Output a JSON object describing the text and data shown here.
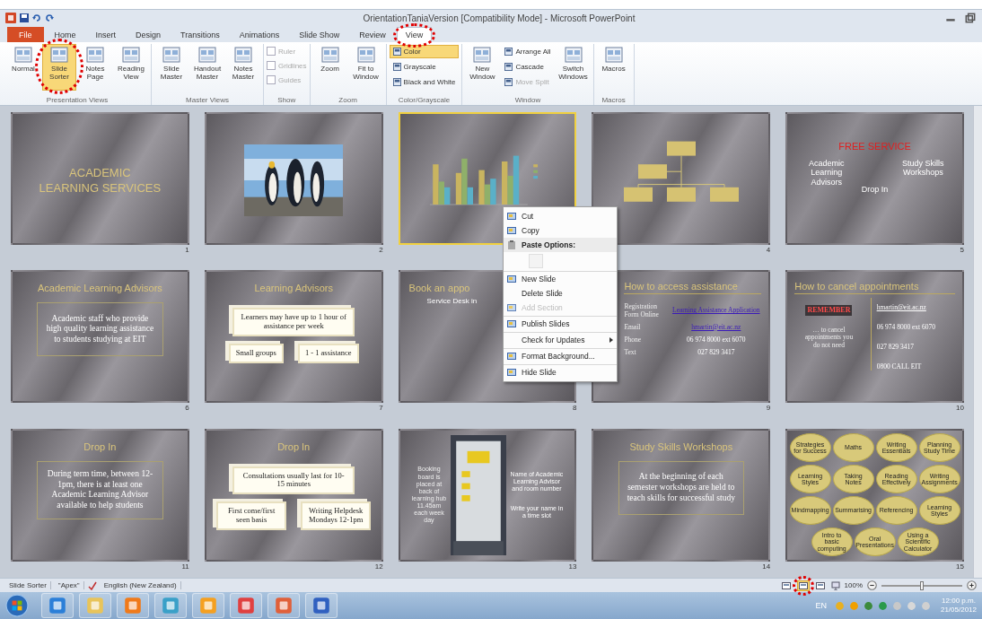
{
  "window": {
    "title": "OrientationTaniaVersion [Compatibility Mode] - Microsoft PowerPoint"
  },
  "tabs": [
    {
      "label": "File",
      "kind": "file",
      "selected": false,
      "circled": false
    },
    {
      "label": "Home",
      "kind": "tab",
      "selected": false,
      "circled": false
    },
    {
      "label": "Insert",
      "kind": "tab",
      "selected": false,
      "circled": false
    },
    {
      "label": "Design",
      "kind": "tab",
      "selected": false,
      "circled": false
    },
    {
      "label": "Transitions",
      "kind": "tab",
      "selected": false,
      "circled": false
    },
    {
      "label": "Animations",
      "kind": "tab",
      "selected": false,
      "circled": false
    },
    {
      "label": "Slide Show",
      "kind": "tab",
      "selected": false,
      "circled": false
    },
    {
      "label": "Review",
      "kind": "tab",
      "selected": false,
      "circled": false
    },
    {
      "label": "View",
      "kind": "tab",
      "selected": true,
      "circled": true
    }
  ],
  "ribbon": [
    {
      "label": "Presentation Views",
      "items": [
        {
          "kind": "large",
          "label": "Normal",
          "selected": false,
          "circled": false
        },
        {
          "kind": "large",
          "label": "Slide Sorter",
          "selected": true,
          "circled": true
        },
        {
          "kind": "large",
          "label": "Notes Page",
          "selected": false,
          "circled": false
        },
        {
          "kind": "large",
          "label": "Reading View",
          "selected": false,
          "circled": false
        }
      ]
    },
    {
      "label": "Master Views",
      "items": [
        {
          "kind": "large",
          "label": "Slide Master",
          "selected": false,
          "circled": false
        },
        {
          "kind": "large",
          "label": "Handout Master",
          "selected": false,
          "circled": false
        },
        {
          "kind": "large",
          "label": "Notes Master",
          "selected": false,
          "circled": false
        }
      ]
    },
    {
      "label": "Show",
      "items": [
        {
          "kind": "check",
          "label": "Ruler",
          "checked": false,
          "disabled": true
        },
        {
          "kind": "check",
          "label": "Gridlines",
          "checked": false,
          "disabled": true
        },
        {
          "kind": "check",
          "label": "Guides",
          "checked": false,
          "disabled": true
        }
      ]
    },
    {
      "label": "Zoom",
      "items": [
        {
          "kind": "large",
          "label": "Zoom",
          "selected": false,
          "circled": false
        },
        {
          "kind": "large",
          "label": "Fit to Window",
          "selected": false,
          "circled": false
        }
      ]
    },
    {
      "label": "Color/Grayscale",
      "items": [
        {
          "kind": "small",
          "label": "Color",
          "selected": true,
          "disabled": false
        },
        {
          "kind": "small",
          "label": "Grayscale",
          "selected": false,
          "disabled": false
        },
        {
          "kind": "small",
          "label": "Black and White",
          "selected": false,
          "disabled": false
        }
      ]
    },
    {
      "label": "Window",
      "items": [
        {
          "kind": "large",
          "label": "New Window",
          "selected": false,
          "circled": false
        },
        {
          "kind": "small",
          "label": "Arrange All",
          "selected": false,
          "disabled": false
        },
        {
          "kind": "small",
          "label": "Cascade",
          "selected": false,
          "disabled": false
        },
        {
          "kind": "small",
          "label": "Move Split",
          "selected": false,
          "disabled": true
        },
        {
          "kind": "large",
          "label": "Switch Windows",
          "selected": false,
          "circled": false
        }
      ]
    },
    {
      "label": "Macros",
      "items": [
        {
          "kind": "large",
          "label": "Macros",
          "selected": false,
          "circled": false
        }
      ]
    }
  ],
  "slides": [
    {
      "number": "1",
      "selected": false,
      "kind": "title",
      "title": "ACADEMIC LEARNING SERVICES"
    },
    {
      "number": "2",
      "selected": false,
      "kind": "picture"
    },
    {
      "selected": true,
      "kind": "chart"
    },
    {
      "number": "4",
      "selected": false,
      "kind": "org"
    },
    {
      "number": "5",
      "selected": false,
      "kind": "diagram",
      "title": "FREE SERVICE",
      "labels": [
        "Academic Learning Advisors",
        "Study Skills Workshops",
        "Drop In"
      ]
    },
    {
      "number": "6",
      "selected": false,
      "kind": "textbox",
      "title": "Academic Learning Advisors",
      "body": "Academic staff who provide high quality learning assistance to students studying at EIT"
    },
    {
      "number": "7",
      "selected": false,
      "kind": "cards",
      "title": "Learning Advisors",
      "cards": [
        "Learners may have up to 1 hour of assistance per week",
        "Small groups",
        "1 - 1 assistance"
      ]
    },
    {
      "number": "8",
      "selected": false,
      "kind": "heading",
      "title": "Book an appo",
      "subtitle": "Service Desk in"
    },
    {
      "number": "9",
      "selected": false,
      "kind": "table",
      "title": "How to access assistance",
      "rows": [
        {
          "label": "Registration Form Online",
          "value": "Learning Assistance Application",
          "link": true
        },
        {
          "label": "Email",
          "value": "hmartin@eit.ac.nz",
          "link": true
        },
        {
          "label": "Phone",
          "value": "06 974 8000 ext 6070",
          "link": false
        },
        {
          "label": "Text",
          "value": "027 829 3417",
          "link": false
        }
      ]
    },
    {
      "number": "10",
      "selected": false,
      "kind": "columns",
      "title": "How to cancel appointments",
      "left": [
        {
          "text": "REMEMBER",
          "alert": true
        },
        {
          "text": "… to cancel appointments you do not need",
          "alert": false
        }
      ],
      "right": [
        {
          "text": "hmartin@eit.ac.nz",
          "link": true
        },
        {
          "text": "06 974 8000 ext 6070",
          "link": false
        },
        {
          "text": "027 829 3417",
          "link": false
        },
        {
          "text": "0800 CALL EIT",
          "link": false
        }
      ]
    },
    {
      "number": "11",
      "selected": false,
      "kind": "textbox",
      "title": "Drop In",
      "body": "During term time, between 12-1pm, there is at least one Academic Learning Advisor available to help students"
    },
    {
      "number": "12",
      "selected": false,
      "kind": "cards",
      "title": "Drop In",
      "cards": [
        "Consultations usually last for 10-15 minutes",
        "First come/first seen basis",
        "Writing Helpdesk Mondays 12-1pm"
      ]
    },
    {
      "number": "13",
      "selected": false,
      "note": "Booking board is placed at back of learning hub 11.45am each week day",
      "notes": [
        "Name of Academic Learning Advisor and room number",
        "Write your name in a time slot"
      ]
    },
    {
      "number": "14",
      "selected": false,
      "kind": "textbox",
      "title": "Study Skills Workshops",
      "body": "At the beginning of each semester workshops are held to teach skills for successful study"
    },
    {
      "number": "15",
      "selected": false,
      "kind": "bubbles",
      "bubbles": [
        "Strategies for Success",
        "Maths",
        "Writing Essentials",
        "Planning Study Time",
        "Learning Styles",
        "Taking Notes",
        "Reading Effectively",
        "Writing Assignments",
        "Mindmapping",
        "Summarising",
        "Referencing",
        "Learning Styles",
        "Intro to basic computing",
        "Oral Presentations",
        "Using a Scientific Calculator"
      ]
    }
  ],
  "context_menu": [
    {
      "kind": "item",
      "label": "Cut",
      "icon": true,
      "disabled": false,
      "separator_before": false,
      "submenu": false
    },
    {
      "kind": "item",
      "label": "Copy",
      "icon": true,
      "disabled": false,
      "separator_before": false,
      "submenu": false
    },
    {
      "kind": "header",
      "label": "Paste Options:",
      "icon": true
    },
    {
      "kind": "paste",
      "disabled": true
    },
    {
      "kind": "item",
      "label": "New Slide",
      "icon": true,
      "disabled": false,
      "separator_before": true,
      "submenu": false
    },
    {
      "kind": "item",
      "label": "Delete Slide",
      "icon": false,
      "disabled": false,
      "separator_before": false,
      "submenu": false
    },
    {
      "kind": "item",
      "label": "Add Section",
      "icon": true,
      "disabled": true,
      "separator_before": false,
      "submenu": false
    },
    {
      "kind": "item",
      "label": "Publish Slides",
      "icon": true,
      "disabled": false,
      "separator_before": true,
      "submenu": false
    },
    {
      "kind": "item",
      "label": "Check for Updates",
      "icon": false,
      "disabled": false,
      "separator_before": true,
      "submenu": true
    },
    {
      "kind": "item",
      "label": "Format Background...",
      "icon": true,
      "disabled": false,
      "separator_before": true,
      "submenu": false
    },
    {
      "kind": "item",
      "label": "Hide Slide",
      "icon": true,
      "disabled": false,
      "separator_before": true,
      "submenu": false
    }
  ],
  "status_bar": {
    "items": [
      "Slide Sorter",
      "\"Apex\"",
      "English (New Zealand)"
    ],
    "views": [
      {
        "selected": false,
        "circled": false
      },
      {
        "selected": true,
        "circled": true
      },
      {
        "selected": false,
        "circled": false
      }
    ],
    "zoom": "100%",
    "zoom_slider": {
      "level": 0.5
    }
  },
  "taskbar": {
    "language": "EN",
    "time": "12:00 p.m.",
    "date": "21/05/2012"
  }
}
